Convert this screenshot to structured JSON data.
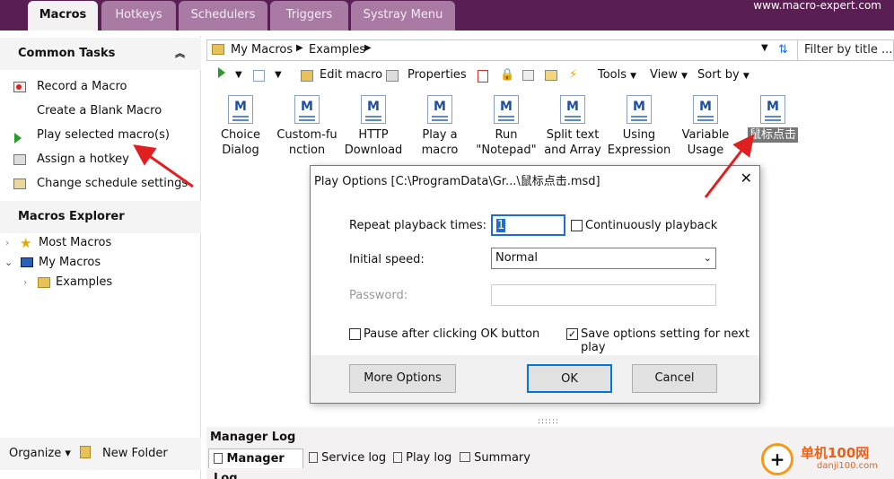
{
  "tabs": [
    "Macros",
    "Hotkeys",
    "Schedulers",
    "Triggers",
    "Systray Menu"
  ],
  "site": "www.macro-expert.com",
  "left": {
    "common_tasks_title": "Common Tasks",
    "tasks": [
      "Record a Macro",
      "Create a Blank Macro",
      "Play selected macro(s)",
      "Assign a hotkey",
      "Change schedule settings"
    ],
    "explorer_title": "Macros Explorer",
    "tree": [
      "Most Macros",
      "My Macros",
      "Examples"
    ],
    "organize": "Organize",
    "new_folder": "New Folder"
  },
  "address": {
    "crumbs": [
      "My Macros",
      "Examples"
    ],
    "filter_placeholder": "Filter by title ..."
  },
  "toolbar": {
    "edit": "Edit macro",
    "properties": "Properties",
    "tools": "Tools",
    "view": "View",
    "sort": "Sort by"
  },
  "files": [
    [
      "Choice",
      "Dialog"
    ],
    [
      "Custom-fu",
      "nction"
    ],
    [
      "HTTP",
      "Download"
    ],
    [
      "Play a",
      "macro"
    ],
    [
      "Run",
      "\"Notepad\""
    ],
    [
      "Split text",
      "and Array"
    ],
    [
      "Using",
      "Expression"
    ],
    [
      "Variable",
      "Usage"
    ],
    [
      "鼠标点击",
      ""
    ]
  ],
  "log": {
    "title": "Manager Log",
    "tabs": [
      "Manager Log",
      "Service log",
      "Play log",
      "Summary"
    ]
  },
  "dialog": {
    "title": "Play Options [C:\\ProgramData\\Gr...\\鼠标点击.msd]",
    "repeat_label": "Repeat playback times:",
    "repeat_value": "1",
    "continuous_label": "Continuously playback",
    "speed_label": "Initial speed:",
    "speed_value": "Normal",
    "password_label": "Password:",
    "pause_label": "Pause after clicking OK button",
    "save_label": "Save options setting for next play",
    "more_options": "More Options",
    "ok": "OK",
    "cancel": "Cancel"
  },
  "watermark": {
    "cn": "单机100网",
    "url": "danji100.com"
  },
  "colors": {
    "topbar": "#5a1f52",
    "tab_inactive": "#a97aa3",
    "arrow": "#e02020",
    "accent_blue": "#1f4e9e"
  }
}
